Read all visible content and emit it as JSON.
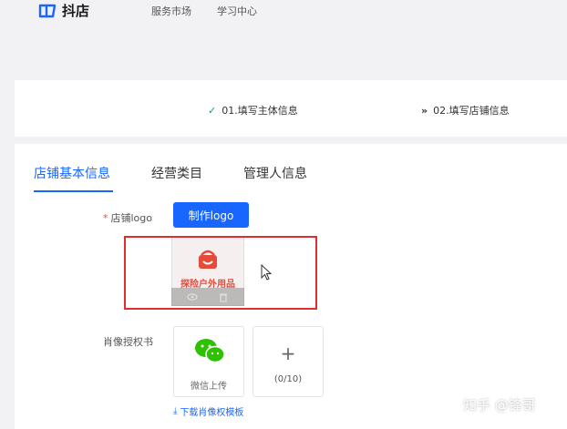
{
  "header": {
    "brand": "抖店",
    "nav": [
      "服务市场",
      "学习中心"
    ]
  },
  "steps": [
    {
      "mark": "✓",
      "label": "01.填写主体信息"
    },
    {
      "mark": "»",
      "label": "02.填写店铺信息"
    }
  ],
  "tabs": [
    {
      "label": "店铺基本信息",
      "active": true
    },
    {
      "label": "经营类目",
      "active": false
    },
    {
      "label": "管理人信息",
      "active": false
    }
  ],
  "form": {
    "required_mark": "*",
    "logo_label": "店铺logo",
    "make_logo_button": "制作logo",
    "logo_preview_text": "探险户外用品",
    "portrait_label": "肖像授权书",
    "wechat_upload_label": "微信上传",
    "add_plus": "+",
    "upload_count": "(0/10)",
    "download_mark": "⤓",
    "download_link": "下载肖像权模板"
  },
  "watermark": "知乎 @锋哥",
  "colors": {
    "accent": "#1966ff",
    "highlight_border": "#e02d2d",
    "step_done": "#1aa05a",
    "wechat_green": "#2dc100"
  }
}
